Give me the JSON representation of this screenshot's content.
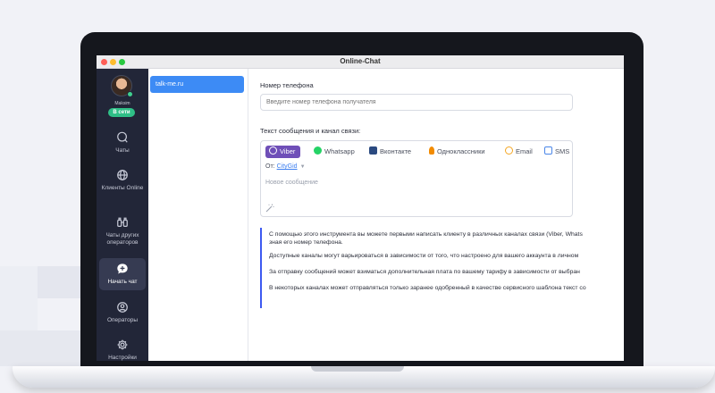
{
  "window": {
    "title": "Online-Chat"
  },
  "user": {
    "name": "Maksim",
    "status": "В сети"
  },
  "rail": {
    "items": [
      {
        "label": "Чаты",
        "icon": "chat-bubble-icon"
      },
      {
        "label": "Клиенты Online",
        "icon": "globe-icon"
      },
      {
        "label": "Чаты других операторов",
        "icon": "binoculars-icon"
      },
      {
        "label": "Начать чат",
        "icon": "new-chat-icon",
        "active": true
      },
      {
        "label": "Операторы",
        "icon": "user-circle-icon"
      },
      {
        "label": "Настройки",
        "icon": "gear-icon"
      }
    ]
  },
  "list": {
    "items": [
      {
        "label": "talk-me.ru",
        "selected": true
      }
    ]
  },
  "form": {
    "phone_label": "Номер телефона",
    "phone_placeholder": "Введите номер телефона получателя",
    "message_label": "Текст сообщения и канал связи:",
    "channels": [
      {
        "label": "Viber",
        "icon": "viber-icon",
        "color": "#6f4fb8",
        "active": true
      },
      {
        "label": "Whatsapp",
        "icon": "whatsapp-icon",
        "color": "#25d366"
      },
      {
        "label": "Вконтакте",
        "icon": "vk-icon",
        "color": "#2b4a80"
      },
      {
        "label": "Одноклассники",
        "icon": "odnoklassniki-icon",
        "color": "#f28b00"
      },
      {
        "label": "Email",
        "icon": "email-at-icon",
        "color": "#f5a623"
      },
      {
        "label": "SMS",
        "icon": "sms-icon",
        "color": "#4a86e8"
      }
    ],
    "from_label": "От:",
    "from_value": "CityGid",
    "message_placeholder": "Новое сообщение"
  },
  "info": {
    "p1_line1": "С помощью этого инструмента вы можете первыми написать клиенту в различных каналах связи (Viber, Whats",
    "p1_line2": "зная его номер телефона.",
    "p2": "Доступные каналы могут варьироваться в зависимости от того, что настроено для вашего аккаунта в личном",
    "p3": "За отправку сообщений может взиматься дополнительная плата по вашему тарифу в зависимости от выбран",
    "p4": "В некоторых каналах может отправляться только заранее одобренный в качестве сервисного шаблона текст со"
  },
  "colors": {
    "accent": "#3d8bf5",
    "rail_bg": "#222638",
    "online": "#2fbf87"
  }
}
